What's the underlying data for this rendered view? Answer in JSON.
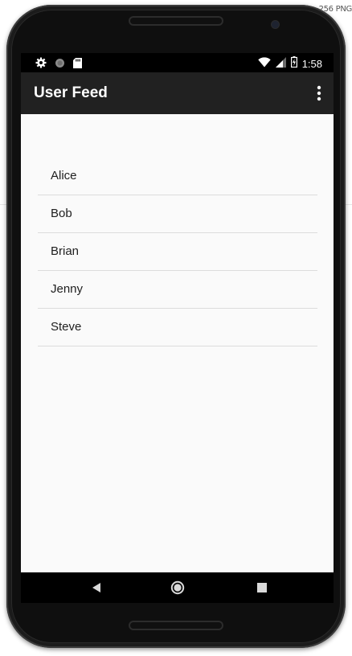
{
  "corner_label": "256 PNG",
  "status_bar": {
    "time": "1:58",
    "left_icons": [
      "settings-icon",
      "circle-icon",
      "sd-card-icon"
    ],
    "right_icons": [
      "wifi-icon",
      "signal-icon",
      "battery-charging-icon"
    ]
  },
  "app_bar": {
    "title": "User Feed",
    "menu_icon": "overflow-menu-icon",
    "color": "#212121"
  },
  "users": [
    "Alice",
    "Bob",
    "Brian",
    "Jenny",
    "Steve"
  ],
  "nav_bar": {
    "buttons": [
      "back-icon",
      "home-icon",
      "recents-icon"
    ]
  },
  "colors": {
    "background": "#fafafa",
    "divider": "#dcdcdc",
    "text": "#202020"
  }
}
